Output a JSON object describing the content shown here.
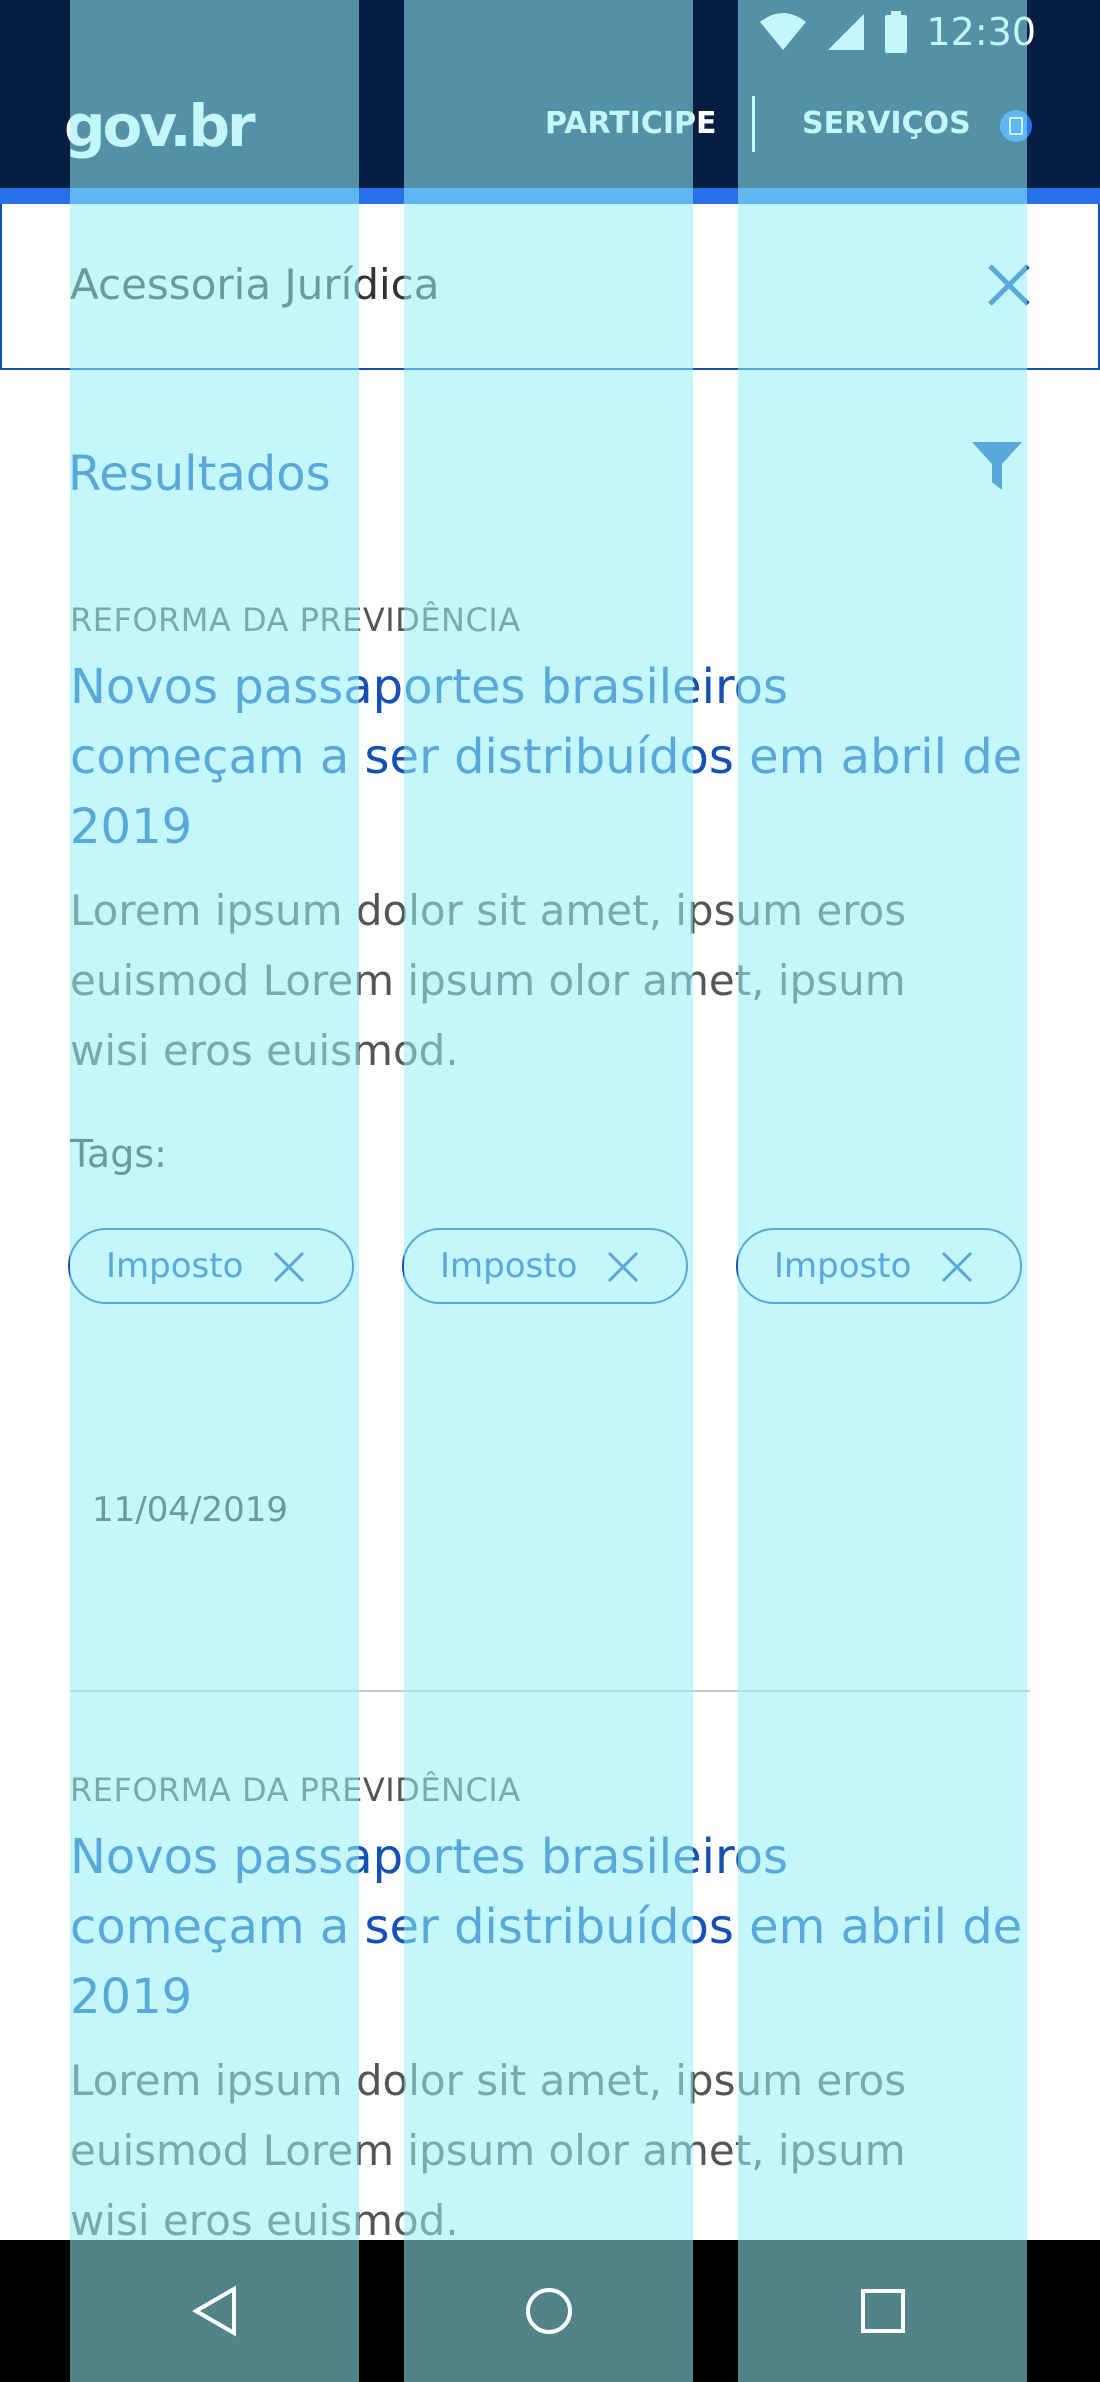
{
  "status_bar": {
    "time": "12:30"
  },
  "header": {
    "logo": "gov.br",
    "nav_participe": "PARTICIPE",
    "nav_servicos": "SERVIÇOS"
  },
  "search": {
    "value": "Acessoria Jurídica"
  },
  "results": {
    "title": "Resultados"
  },
  "cards": [
    {
      "category": "REFORMA DA PREVIDÊNCIA",
      "title": "Novos passaportes brasileiros começam a ser distribuídos em abril de 2019",
      "description": "Lorem ipsum dolor sit amet, ipsum eros euismod Lorem ipsum olor amet, ipsum wisi eros euismod.",
      "tags_label": "Tags:",
      "tags": [
        "Imposto",
        "Imposto",
        "Imposto"
      ],
      "date": "11/04/2019"
    },
    {
      "category": "REFORMA DA PREVIDÊNCIA",
      "title": "Novos passaportes brasileiros começam a ser distribuídos em abril de 2019",
      "description": "Lorem ipsum dolor sit amet, ipsum eros euismod Lorem ipsum olor amet, ipsum wisi eros euismod."
    }
  ],
  "colors": {
    "header_bg": "#071d41",
    "accent": "#1351b4",
    "accent_bar": "#2670e8",
    "overlay": "#91f0fa"
  },
  "icons": [
    "wifi-icon",
    "signal-icon",
    "battery-icon",
    "close-icon",
    "filter-icon",
    "back-icon",
    "home-icon",
    "recents-icon"
  ]
}
